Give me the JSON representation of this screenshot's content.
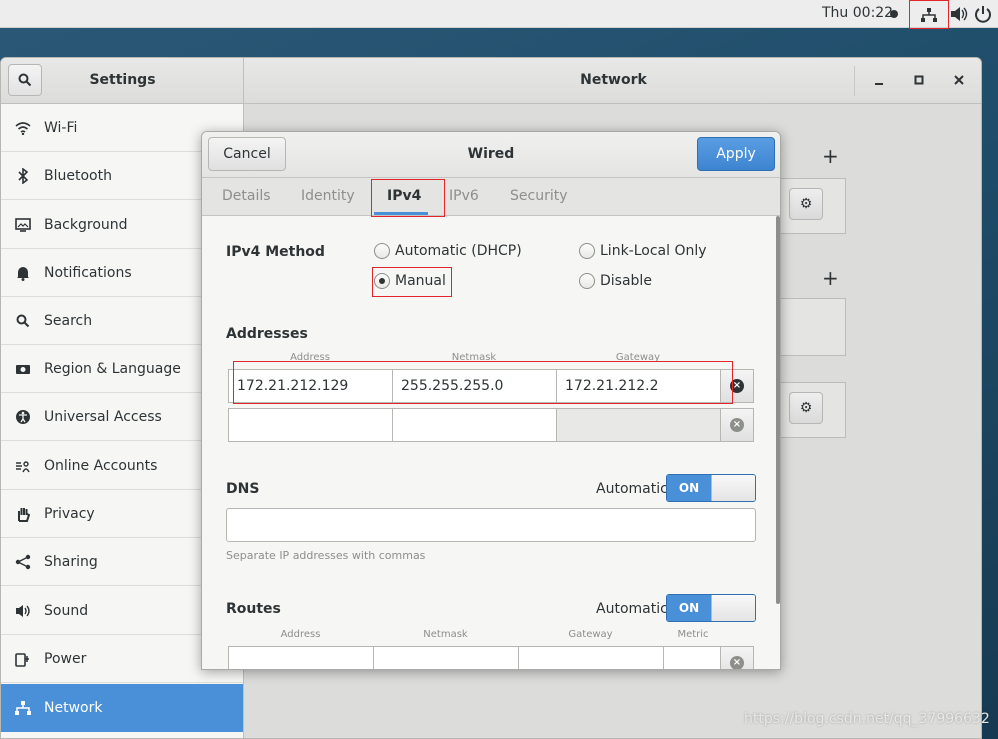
{
  "topbar": {
    "clock": "Thu 00:22"
  },
  "window": {
    "settings_title": "Settings",
    "panel_title": "Network",
    "minimize": "–",
    "maximize": "□",
    "close": "✕"
  },
  "sidebar": {
    "items": [
      {
        "label": "Wi-Fi",
        "icon": "wifi-icon"
      },
      {
        "label": "Bluetooth",
        "icon": "bluetooth-icon"
      },
      {
        "label": "Background",
        "icon": "background-icon"
      },
      {
        "label": "Notifications",
        "icon": "bell-icon"
      },
      {
        "label": "Search",
        "icon": "search-icon"
      },
      {
        "label": "Region & Language",
        "icon": "camera-icon"
      },
      {
        "label": "Universal Access",
        "icon": "accessibility-icon"
      },
      {
        "label": "Online Accounts",
        "icon": "online-accounts-icon"
      },
      {
        "label": "Privacy",
        "icon": "hand-icon"
      },
      {
        "label": "Sharing",
        "icon": "share-icon"
      },
      {
        "label": "Sound",
        "icon": "speaker-icon"
      },
      {
        "label": "Power",
        "icon": "power-plug-icon"
      },
      {
        "label": "Network",
        "icon": "network-icon"
      }
    ],
    "active_index": 12
  },
  "dialog": {
    "cancel": "Cancel",
    "title": "Wired",
    "apply": "Apply",
    "tabs": [
      "Details",
      "Identity",
      "IPv4",
      "IPv6",
      "Security"
    ],
    "active_tab": "IPv4",
    "method_label": "IPv4 Method",
    "methods": {
      "auto_dhcp": "Automatic (DHCP)",
      "link_local": "Link-Local Only",
      "manual": "Manual",
      "disable": "Disable"
    },
    "selected_method": "Manual",
    "addresses_label": "Addresses",
    "addr_headers": {
      "address": "Address",
      "netmask": "Netmask",
      "gateway": "Gateway"
    },
    "address_rows": [
      {
        "address": "172.21.212.129",
        "netmask": "255.255.255.0",
        "gateway": "172.21.212.2"
      },
      {
        "address": "",
        "netmask": "",
        "gateway": ""
      }
    ],
    "dns_label": "DNS",
    "dns_automatic_label": "Automatic",
    "dns_switch": "ON",
    "dns_value": "",
    "dns_hint": "Separate IP addresses with commas",
    "routes_label": "Routes",
    "routes_automatic_label": "Automatic",
    "routes_switch": "ON",
    "route_headers": {
      "address": "Address",
      "netmask": "Netmask",
      "gateway": "Gateway",
      "metric": "Metric"
    }
  },
  "watermark": "https://blog.csdn.net/qq_37996632",
  "colors": {
    "accent": "#4a90d9",
    "highlight": "#e0262a"
  }
}
